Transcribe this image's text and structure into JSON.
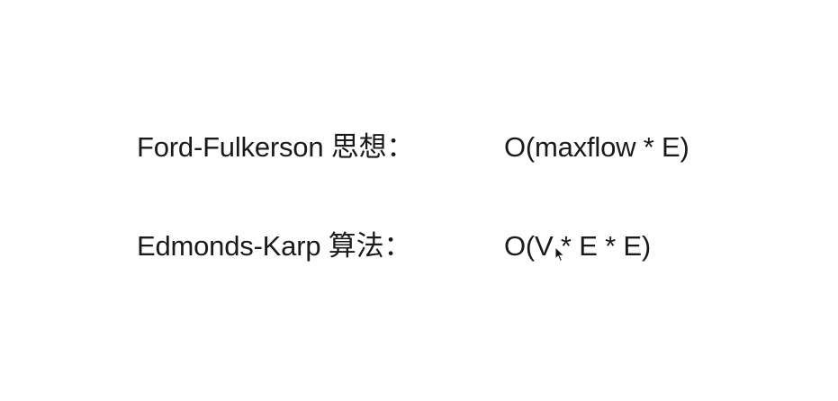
{
  "rows": [
    {
      "label": "Ford-Fulkerson 思想：",
      "complexity": "O(maxflow * E)"
    },
    {
      "label": "Edmonds-Karp 算法：",
      "complexity": "O(V * E * E)"
    }
  ],
  "icons": {
    "cursor": "mouse-pointer-icon"
  },
  "colors": {
    "background": "#ffffff",
    "text": "#1a1a1a"
  }
}
